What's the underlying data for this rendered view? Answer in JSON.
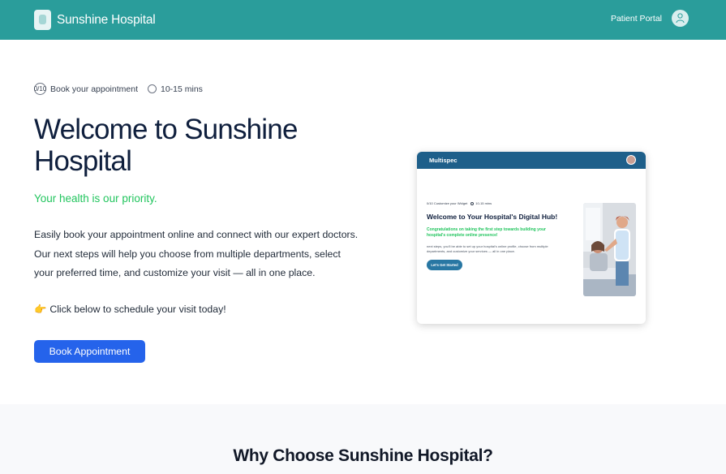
{
  "header": {
    "brand": "Sunshine Hospital",
    "portal_label": "Patient Portal"
  },
  "progress": {
    "step": "0/10",
    "step_label": "Book your appointment",
    "time": "10-15 mins"
  },
  "hero": {
    "title": "Welcome to Sunshine Hospital",
    "tagline": "Your health is our priority.",
    "intro": "Easily book your appointment online and connect with our expert doctors. Our next steps will help you choose from multiple departments, select your preferred time, and customize your visit — all in one place.",
    "cta_text": "Click below to schedule your visit today!",
    "cta_icon": "👉",
    "button": "Book Appointment"
  },
  "preview": {
    "app_name": "Multispec",
    "step": "0/10",
    "step_label": "Customize your Widget",
    "time": "10-15 mins",
    "title": "Welcome to Your Hospital's Digital Hub!",
    "green_text": "Congratulations on taking the first step towards building your hospital's complete online presence!",
    "body": "next steps, you'll be able to set up your hospital's online profile, choose from multiple departments, and customize your services — all in one place.",
    "button": "Let's Get Started"
  },
  "section": {
    "title": "Why Choose Sunshine Hospital?"
  },
  "colors": {
    "header": "#2a9d9b",
    "primary_button": "#2563eb",
    "tagline": "#22c55e",
    "title": "#0f1f3d",
    "preview_header": "#1e5f8a"
  }
}
